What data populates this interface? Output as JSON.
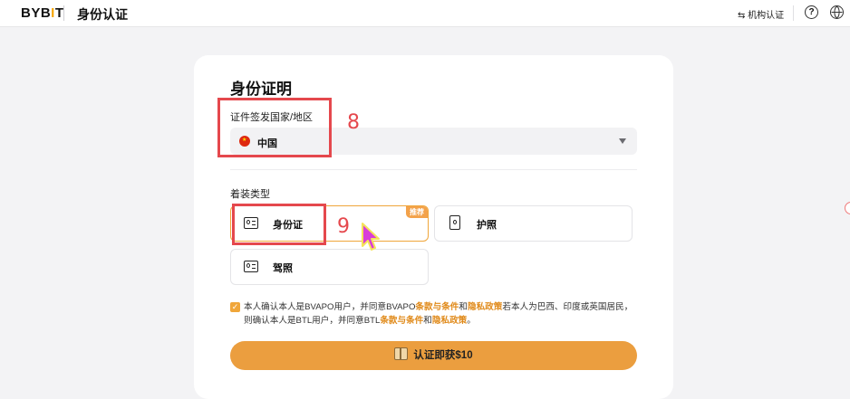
{
  "header": {
    "logo": "BYBIT",
    "title": "身份认证",
    "institutional": "⇆ 机构认证",
    "help_icon": "question-icon",
    "lang_icon": "globe-icon"
  },
  "form": {
    "title": "身份证明",
    "country_label": "证件签发国家/地区",
    "country_value": "中国",
    "doc_type_label": "着装类型",
    "options": [
      {
        "label": "身份证"
      },
      {
        "label": "护照"
      },
      {
        "label": "驾照"
      }
    ],
    "recommended_badge": "推荐",
    "terms": {
      "part1": "本人确认本人是BVAPO用户，并同意BVAPO",
      "link1": "条款与条件",
      "and1": "和",
      "link2": "隐私政策",
      "part2": "若本人为巴西、印度或英国居民，则确认本人是BTL用户，并同意BTL",
      "link3": "条款与条件",
      "and2": "和",
      "link4": "隐私政策",
      "end": "。"
    },
    "cta": "认证即获$10"
  },
  "annotations": {
    "step8": "8",
    "step9": "9"
  },
  "colors": {
    "accent": "#eb9e3f",
    "link": "#e08a1a",
    "annotation": "#e5484d"
  }
}
